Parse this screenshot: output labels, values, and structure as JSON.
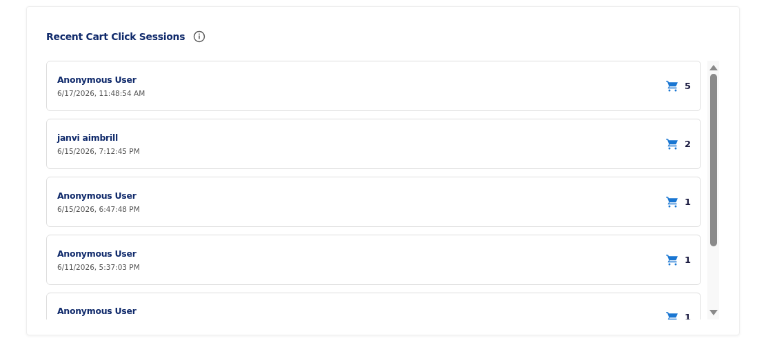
{
  "panel": {
    "title": "Recent Cart Click Sessions"
  },
  "sessions": [
    {
      "user": "Anonymous User",
      "time": "6/17/2026, 11:48:54 AM",
      "count": "5"
    },
    {
      "user": "janvi aimbrill",
      "time": "6/15/2026, 7:12:45 PM",
      "count": "2"
    },
    {
      "user": "Anonymous User",
      "time": "6/15/2026, 6:47:48 PM",
      "count": "1"
    },
    {
      "user": "Anonymous User",
      "time": "6/11/2026, 5:37:03 PM",
      "count": "1"
    },
    {
      "user": "Anonymous User",
      "count": "1"
    }
  ]
}
